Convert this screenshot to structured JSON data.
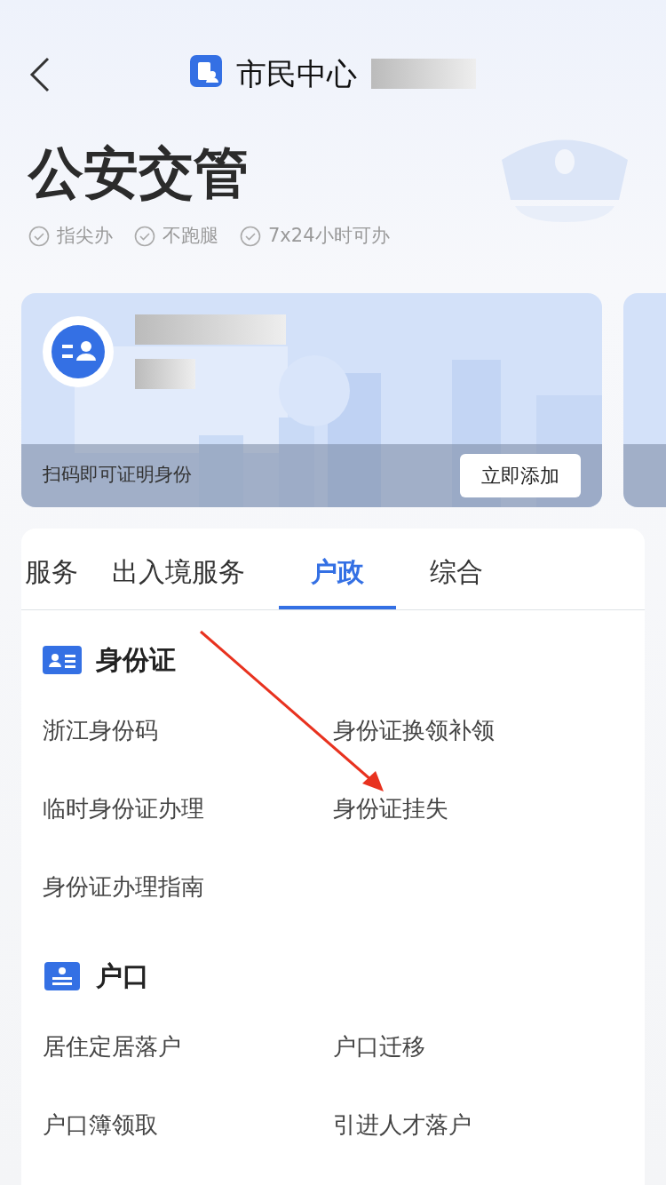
{
  "header": {
    "title": "市民中心"
  },
  "page_title": "公安交管",
  "features": [
    "指尖办",
    "不跑腿",
    "7x24小时可办"
  ],
  "id_card": {
    "caption": "扫码即可证明身份",
    "button": "立即添加"
  },
  "tabs": [
    {
      "label": "服务",
      "selected": false
    },
    {
      "label": "出入境服务",
      "selected": false
    },
    {
      "label": "户政",
      "selected": true
    },
    {
      "label": "综合",
      "selected": false
    }
  ],
  "sections": [
    {
      "kind": "id",
      "title": "身份证",
      "items": [
        "浙江身份码",
        "身份证换领补领",
        "临时身份证办理",
        "身份证挂失",
        "身份证办理指南"
      ]
    },
    {
      "kind": "household",
      "title": "户口",
      "items": [
        "居住定居落户",
        "户口迁移",
        "户口簿领取",
        "引进人才落户"
      ]
    }
  ]
}
